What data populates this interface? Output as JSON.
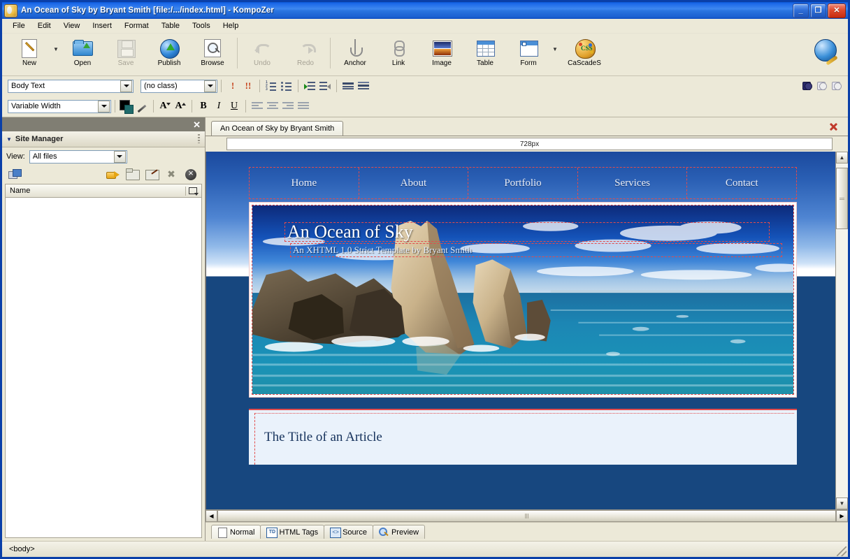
{
  "window": {
    "title": "An Ocean of Sky by Bryant Smith [file:/.../index.html] - KompoZer",
    "minimize": "_",
    "restore": "❐",
    "close": "✕"
  },
  "menu": [
    "File",
    "Edit",
    "View",
    "Insert",
    "Format",
    "Table",
    "Tools",
    "Help"
  ],
  "toolbar": {
    "buttons": [
      {
        "label": "New",
        "icon": "new-document-icon",
        "disabled": false,
        "dropdown": true
      },
      {
        "label": "Open",
        "icon": "open-folder-icon",
        "disabled": false,
        "dropdown": false
      },
      {
        "label": "Save",
        "icon": "floppy-save-icon",
        "disabled": true,
        "dropdown": false
      },
      {
        "label": "Publish",
        "icon": "publish-globe-icon",
        "disabled": false,
        "dropdown": false
      },
      {
        "label": "Browse",
        "icon": "browse-magnifier-icon",
        "disabled": false,
        "dropdown": false
      },
      {
        "label": "Undo",
        "icon": "undo-arrow-icon",
        "disabled": true,
        "dropdown": false
      },
      {
        "label": "Redo",
        "icon": "redo-arrow-icon",
        "disabled": true,
        "dropdown": false
      },
      {
        "label": "Anchor",
        "icon": "anchor-icon",
        "disabled": false,
        "dropdown": false
      },
      {
        "label": "Link",
        "icon": "chain-link-icon",
        "disabled": false,
        "dropdown": false
      },
      {
        "label": "Image",
        "icon": "image-icon",
        "disabled": false,
        "dropdown": false
      },
      {
        "label": "Table",
        "icon": "table-grid-icon",
        "disabled": false,
        "dropdown": false
      },
      {
        "label": "Form",
        "icon": "form-window-icon",
        "disabled": false,
        "dropdown": true
      },
      {
        "label": "CaScadeS",
        "icon": "css-palette-icon",
        "disabled": false,
        "dropdown": false
      }
    ],
    "css_badge": "CSS"
  },
  "format_bar": {
    "paragraph_style": "Body Text",
    "class_style": "(no class)",
    "font_name": "Variable Width",
    "emphasis": "!",
    "strong_emphasis": "!!",
    "bold": "B",
    "italic": "I",
    "underline": "U",
    "decrease_size": "A",
    "increase_size": "A"
  },
  "sidebar": {
    "panel_title": "Site Manager",
    "close_label": "✕",
    "view_label": "View:",
    "view_value": "All files",
    "column_header": "Name",
    "tools": [
      {
        "name": "edit-sites-icon"
      },
      {
        "name": "publish-arrow-icon"
      },
      {
        "name": "new-folder-icon"
      },
      {
        "name": "rename-icon"
      },
      {
        "name": "delete-icon"
      },
      {
        "name": "cancel-icon"
      }
    ],
    "files": []
  },
  "editor": {
    "document_tab": "An Ocean of Sky by Bryant Smith",
    "width_indicator": "728px",
    "mode_tabs": [
      {
        "label": "Normal",
        "icon": "page-icon",
        "active": true
      },
      {
        "label": "HTML Tags",
        "icon": "html-tags-icon",
        "active": false
      },
      {
        "label": "Source",
        "icon": "source-code-icon",
        "active": false
      },
      {
        "label": "Preview",
        "icon": "preview-magnifier-icon",
        "active": false
      }
    ]
  },
  "page": {
    "nav": [
      "Home",
      "About",
      "Portfolio",
      "Services",
      "Contact"
    ],
    "site_title": "An Ocean of Sky",
    "site_subtitle": "An XHTML 1.0 Strict Template by Bryant Smith",
    "article_title": "The Title of an Article",
    "photo_alt": "rocky-coastline-ocean-photo"
  },
  "status": {
    "tag_path": "<body>"
  },
  "colors": {
    "title_bar": "#1b68e8",
    "chrome": "#ece9d8",
    "page_blue": "#17477f",
    "guide_red": "#e34b4b",
    "article_bg": "#eaf2fb"
  }
}
